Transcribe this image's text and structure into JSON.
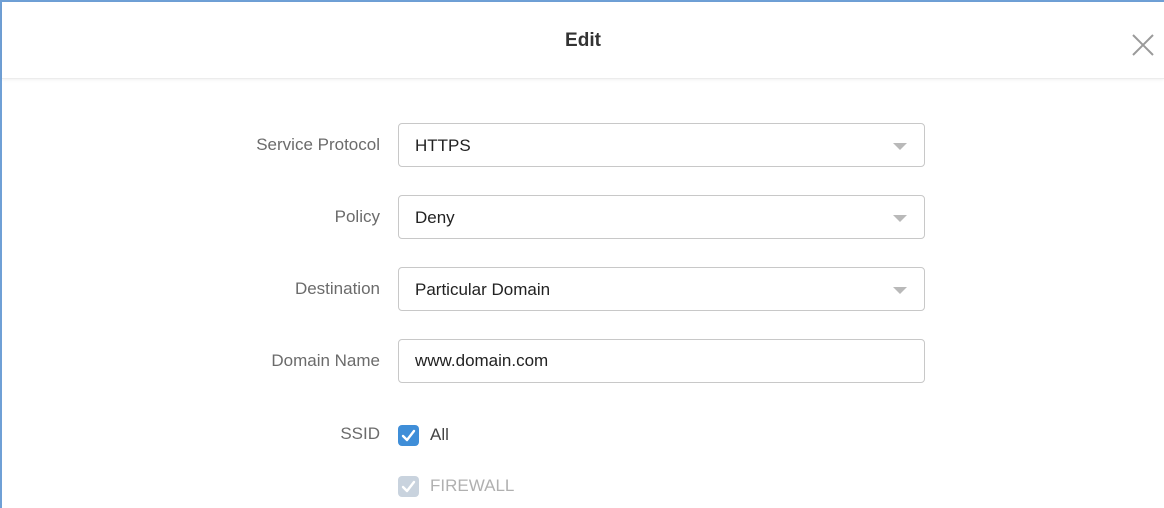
{
  "dialog": {
    "title": "Edit",
    "close_icon": "close-icon"
  },
  "form": {
    "service_protocol": {
      "label": "Service Protocol",
      "value": "HTTPS"
    },
    "policy": {
      "label": "Policy",
      "value": "Deny"
    },
    "destination": {
      "label": "Destination",
      "value": "Particular Domain"
    },
    "domain_name": {
      "label": "Domain Name",
      "value": "www.domain.com"
    },
    "ssid": {
      "label": "SSID",
      "options": [
        {
          "label": "All",
          "checked": true,
          "disabled": false
        },
        {
          "label": "FIREWALL",
          "checked": true,
          "disabled": true
        }
      ]
    }
  },
  "colors": {
    "accent": "#3f8ed8",
    "border_accent": "#6fa0d6",
    "disabled_check": "#c9d3de"
  }
}
